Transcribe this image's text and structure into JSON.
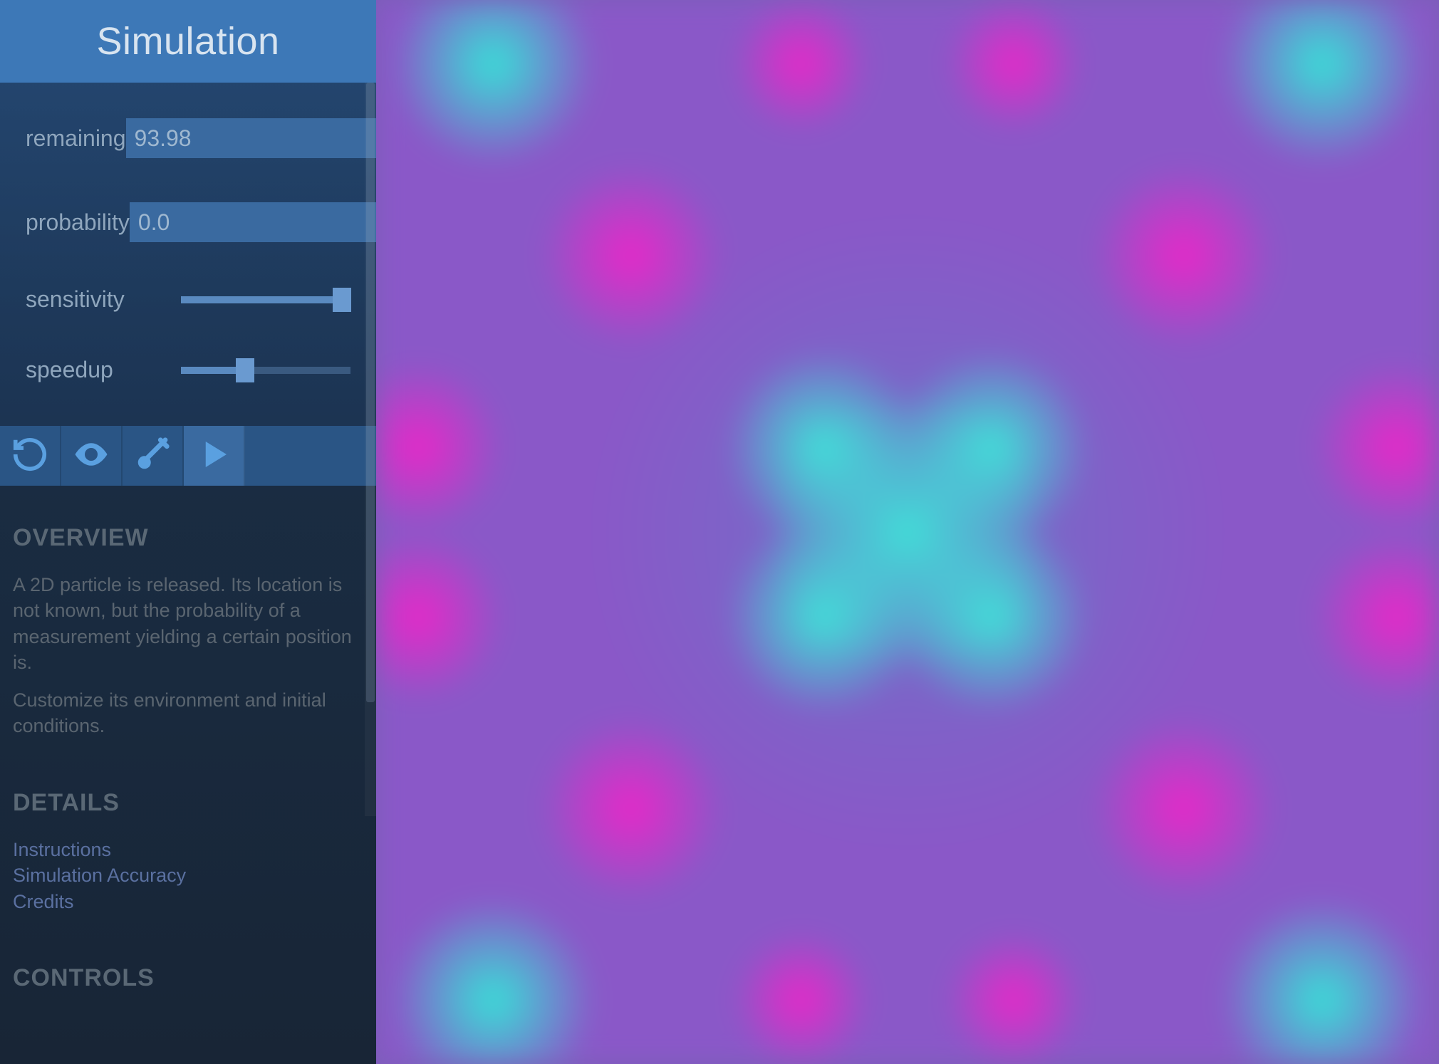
{
  "header": {
    "title": "Simulation"
  },
  "controls": {
    "remaining": {
      "label": "remaining",
      "value": "93.98"
    },
    "probability": {
      "label": "probability",
      "value": "0.0"
    },
    "sensitivity": {
      "label": "sensitivity",
      "value": 95
    },
    "speedup": {
      "label": "speedup",
      "value": 38
    }
  },
  "toolbar": {
    "reset": "reset",
    "eye": "view",
    "brush": "draw",
    "play": "play"
  },
  "overview": {
    "heading": "OVERVIEW",
    "p1": "A 2D particle is released.  Its location is not known, but the probability of a measurement yielding a certain position is.",
    "p2": "Customize its environment and initial conditions."
  },
  "details": {
    "heading": "DETAILS",
    "links": {
      "instructions": "Instructions",
      "accuracy": "Simulation Accuracy",
      "credits": "Credits"
    }
  },
  "controls_heading": "CONTROLS"
}
